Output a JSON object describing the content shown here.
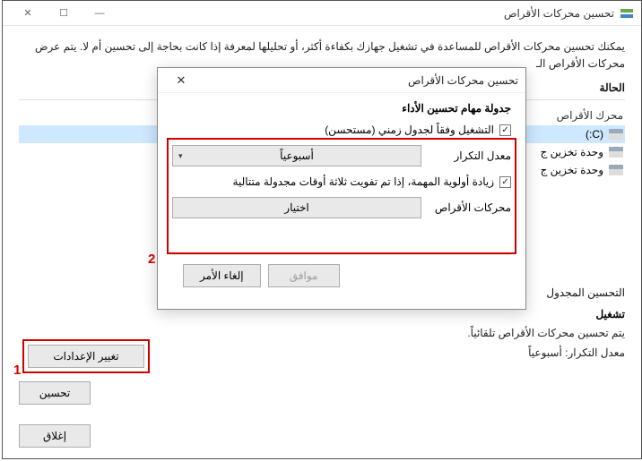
{
  "window": {
    "title": "تحسين محركات الأقراص",
    "min": "—",
    "max": "☐",
    "close": "✕"
  },
  "description": "يمكنك تحسين محركات الأقراص للمساعدة في تشغيل جهازك بكفاءة أكثر، أو تحليلها لمعرفة إذا كانت بحاجة إلى تحسين أم لا. يتم عرض محركات الأقراص الـ",
  "status_label": "الحالة",
  "drives_header": "محرك الأقراص",
  "drives": [
    {
      "name": "(C:)"
    },
    {
      "name": "وحدة تخزين ج"
    },
    {
      "name": "وحدة تخزين ج"
    }
  ],
  "optimize_btn": "تحسين",
  "schedule": {
    "title": "التحسين المجدول",
    "status_label": "تشغيل",
    "status_desc": "يتم تحسين محركات الأقراص تلقائياً.",
    "freq": "معدل التكرار: أسبوعياً",
    "change_btn": "تغيير الإعدادات"
  },
  "close_btn": "إغلاق",
  "modal": {
    "title": "تحسين محركات الأقراص",
    "close": "✕",
    "section": "جدولة مهام تحسين الأداء",
    "run_sched": "التشغيل وفقاً لجدول زمني (مستحسن)",
    "freq_label": "معدل التكرار",
    "freq_value": "أسبوعياً",
    "priority": "زيادة أولوية المهمة، إذا تم تفويت ثلاثة أوقات مجدولة متتالية",
    "drives_label": "محركات الأقراص",
    "choose": "اختيار",
    "ok": "موافق",
    "cancel": "إلغاء الأمر"
  },
  "annotations": {
    "one": "1",
    "two": "2"
  }
}
